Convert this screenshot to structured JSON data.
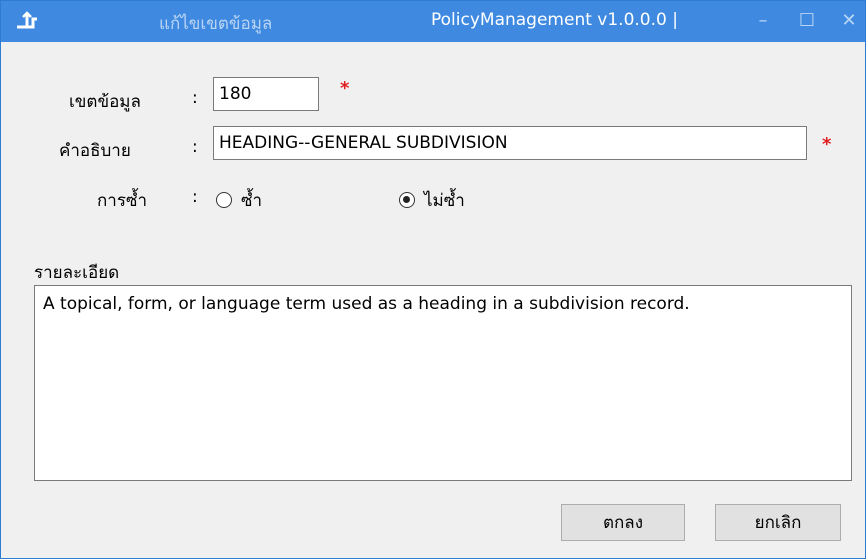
{
  "window": {
    "title": "แก้ไขเขตข้อมูล",
    "app_name": "PolicyManagement v1.0.0.0 |",
    "minimize": "–",
    "maximize": "☐",
    "close": "✕"
  },
  "form": {
    "field_label": "เขตข้อมูล",
    "field_value": "180",
    "description_label": "คำอธิบาย",
    "description_value": "HEADING--GENERAL SUBDIVISION",
    "repeat_label": "การซ้ำ",
    "colon": ":",
    "required_mark": "*",
    "repeat_options": [
      {
        "label": "ซ้ำ",
        "selected": false
      },
      {
        "label": "ไม่ซ้ำ",
        "selected": true
      }
    ],
    "details_label": "รายละเอียด",
    "details_value": "A topical, form, or language term used as a heading in a subdivision record."
  },
  "buttons": {
    "ok": "ตกลง",
    "cancel": "ยกเลิก"
  },
  "colors": {
    "titlebar": "#3f8ae0",
    "required": "#e02020"
  }
}
